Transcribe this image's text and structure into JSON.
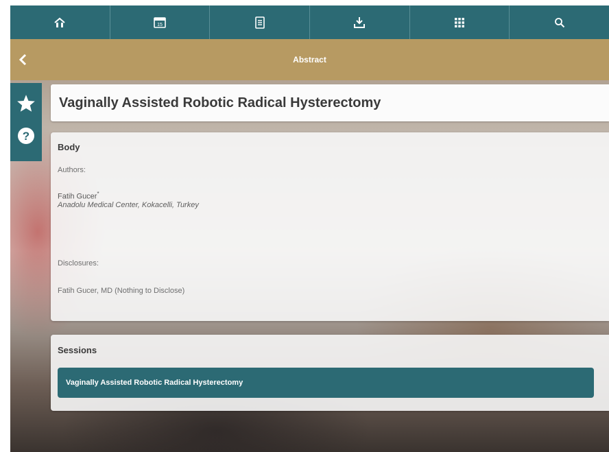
{
  "nav": {
    "items": [
      {
        "icon": "home-icon"
      },
      {
        "icon": "calendar-icon",
        "text": "15"
      },
      {
        "icon": "schedule-icon"
      },
      {
        "icon": "download-icon"
      },
      {
        "icon": "grid-menu-icon"
      },
      {
        "icon": "search-icon"
      }
    ]
  },
  "header": {
    "title": "Abstract",
    "back_icon": "chevron-left-icon"
  },
  "sidebar": {
    "items": [
      {
        "icon": "star-icon"
      },
      {
        "icon": "help-icon",
        "text": "?"
      }
    ]
  },
  "abstract": {
    "title": "Vaginally Assisted Robotic Radical Hysterectomy",
    "body": {
      "heading": "Body",
      "authors_label": "Authors:",
      "author_name": "Fatih Gucer",
      "author_marker": "*",
      "affiliation": "Anadolu Medical Center, Kokacelli, Turkey",
      "disclosures_label": "Disclosures:",
      "disclosure_text": "Fatih Gucer, MD (Nothing to Disclose)"
    },
    "sessions": {
      "heading": "Sessions",
      "items": [
        {
          "label": "Vaginally Assisted Robotic Radical Hysterectomy"
        }
      ]
    }
  },
  "colors": {
    "teal": "#2c6a74",
    "gold": "#b79a62",
    "card": "#f6f6f6"
  }
}
